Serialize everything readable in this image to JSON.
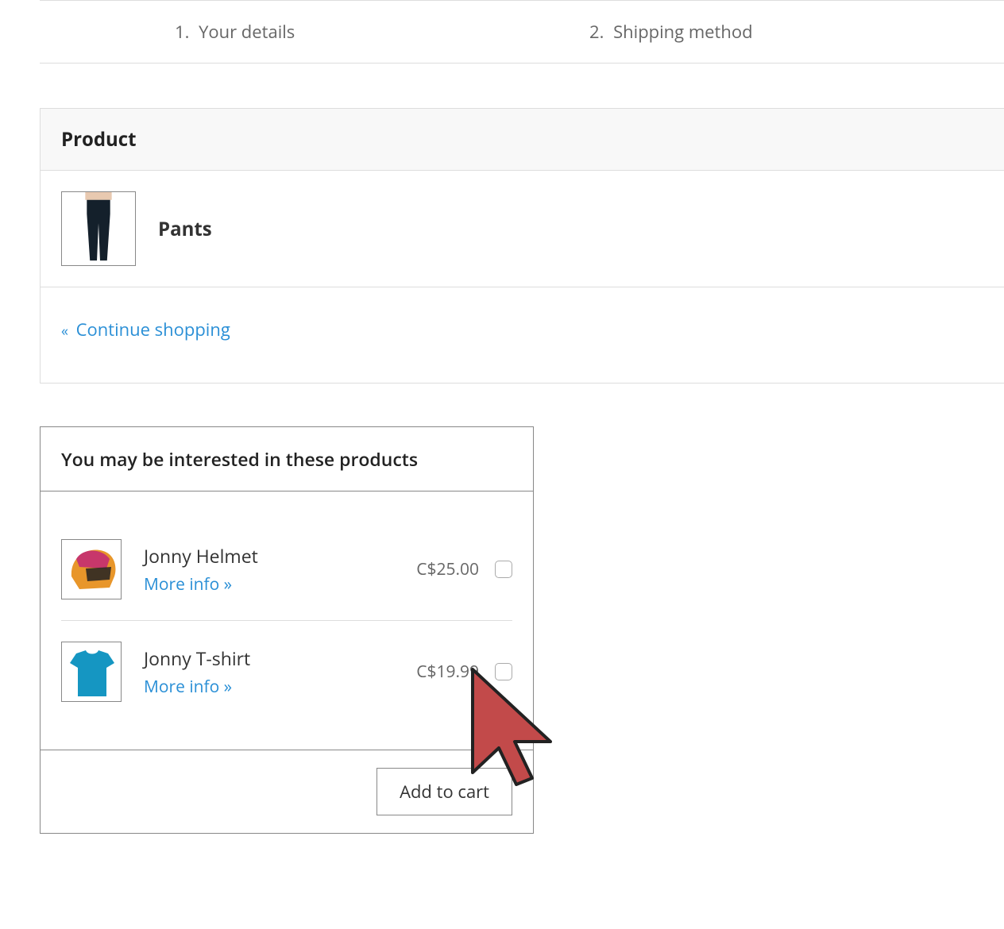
{
  "steps": [
    {
      "num": "1.",
      "label": "Your details"
    },
    {
      "num": "2.",
      "label": "Shipping method"
    }
  ],
  "cart": {
    "header": "Product",
    "item": {
      "name": "Pants"
    },
    "continue": "Continue shopping"
  },
  "upsell": {
    "title": "You may be interested in these products",
    "more_info": "More info »",
    "items": [
      {
        "name": "Jonny Helmet",
        "price": "C$25.00"
      },
      {
        "name": "Jonny T-shirt",
        "price": "C$19.99"
      }
    ],
    "add_to_cart": "Add to cart"
  }
}
